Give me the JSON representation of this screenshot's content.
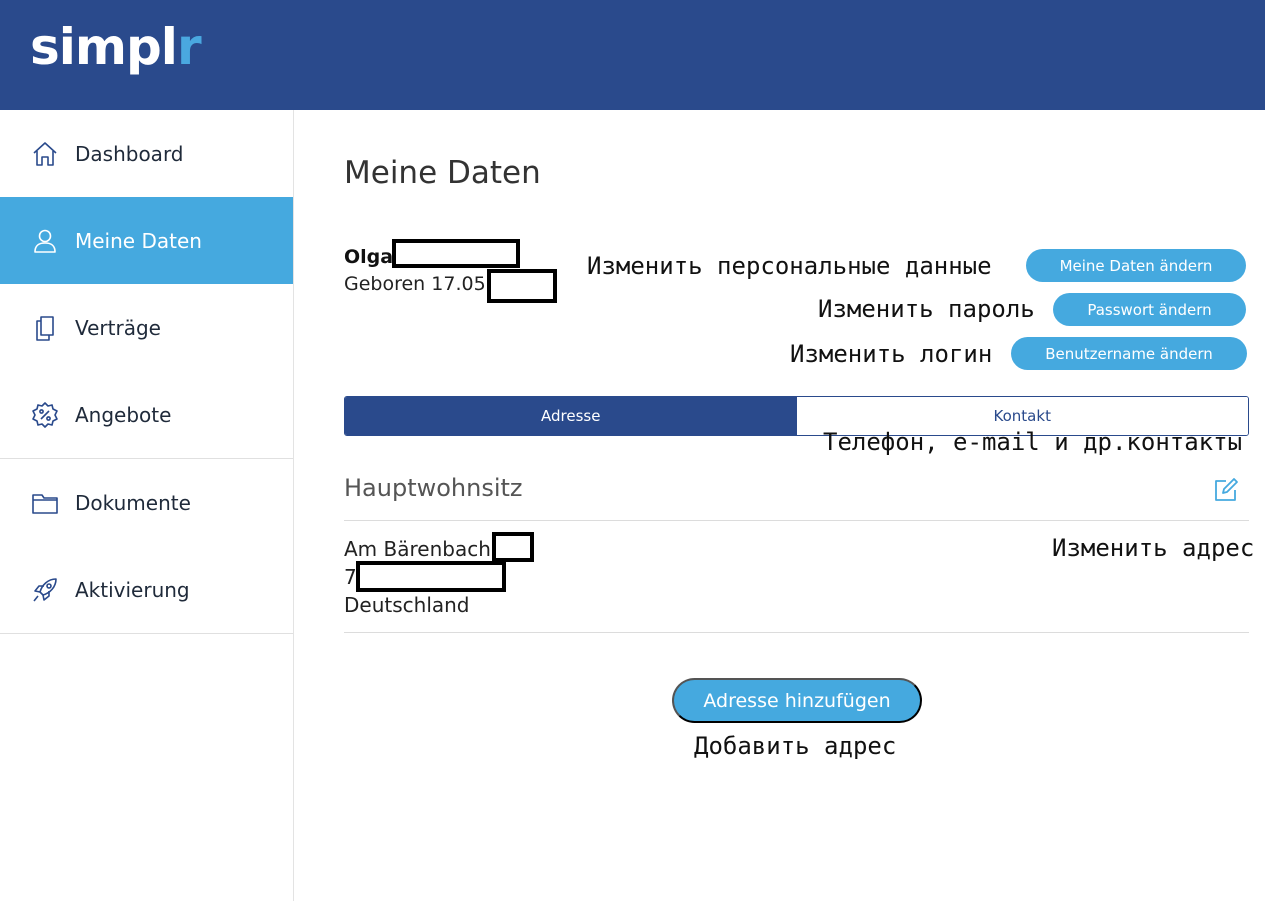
{
  "app": {
    "logo_main": "simpl",
    "logo_accent": "r"
  },
  "sidebar": {
    "items": [
      {
        "label": "Dashboard",
        "icon": "home-icon"
      },
      {
        "label": "Meine Daten",
        "icon": "user-icon"
      },
      {
        "label": "Verträge",
        "icon": "documents-icon"
      },
      {
        "label": "Angebote",
        "icon": "percent-badge-icon"
      },
      {
        "label": "Dokumente",
        "icon": "folder-icon"
      },
      {
        "label": "Aktivierung",
        "icon": "rocket-icon"
      }
    ]
  },
  "main": {
    "title": "Meine Daten",
    "person": {
      "name": "Olga",
      "born": "Geboren 17.05."
    },
    "buttons": {
      "change_data": "Meine Daten ändern",
      "change_password": "Passwort ändern",
      "change_username": "Benutzername ändern",
      "add_address": "Adresse hinzufügen"
    },
    "tabs": [
      {
        "label": "Adresse",
        "active": true
      },
      {
        "label": "Kontakt",
        "active": false
      }
    ],
    "section_title": "Hauptwohnsitz",
    "address": {
      "street": "Am Bärenbach",
      "zip": "7",
      "country": "Deutschland"
    }
  },
  "annotations": {
    "change_personal": "Изменить персональные данные",
    "change_password": "Изменить пароль",
    "change_login": "Изменить логин",
    "contacts": "Телефон, e-mail и др.контакты",
    "change_address": "Изменить адрес",
    "add_address": "Добавить адрес"
  },
  "colors": {
    "header": "#2a4a8c",
    "accent": "#45a9df"
  }
}
